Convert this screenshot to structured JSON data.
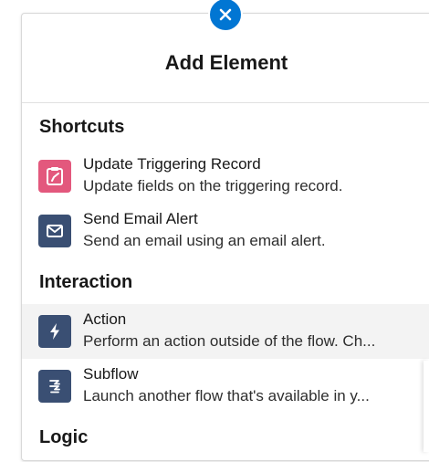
{
  "header": {
    "title": "Add Element"
  },
  "sections": {
    "shortcuts": "Shortcuts",
    "interaction": "Interaction",
    "logic": "Logic"
  },
  "items": [
    {
      "label": "Update Triggering Record",
      "description": "Update fields on the triggering record.",
      "icon": "update-record-icon",
      "icon_color": "#e3587d"
    },
    {
      "label": "Send Email Alert",
      "description": "Send an email using an email alert.",
      "icon": "email-icon",
      "icon_color": "#3a4f73"
    },
    {
      "label": "Action",
      "description": "Perform an action outside of the flow. Ch...",
      "icon": "lightning-icon",
      "icon_color": "#3a4f73"
    },
    {
      "label": "Subflow",
      "description": "Launch another flow that's available in y...",
      "icon": "subflow-icon",
      "icon_color": "#3a4f73"
    }
  ],
  "colors": {
    "close_button": "#0176d3",
    "hover_background": "#f3f3f3"
  }
}
